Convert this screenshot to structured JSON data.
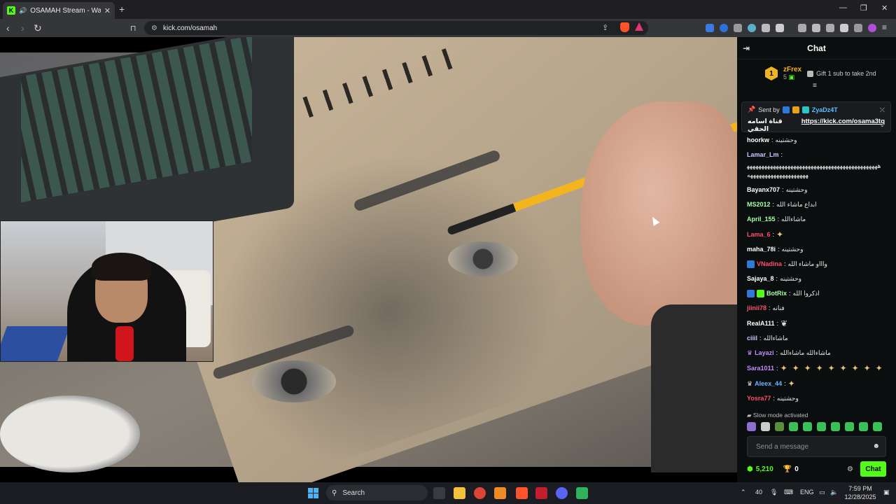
{
  "browser": {
    "tab_title": "OSAMAH Stream - Watch Live",
    "url": "kick.com/osamah"
  },
  "chat": {
    "header": "Chat",
    "leaderboard": {
      "rank": "1",
      "name": "zFrex",
      "count": "5",
      "gift_text": "Gift 1 sub to take 2nd"
    },
    "pinned": {
      "sent_by_label": "Sent by",
      "sender": "ZyaDz4T",
      "text_ar": "قناة اسامه الحقي",
      "link": "https://kick.com/osama3tq"
    },
    "messages": [
      {
        "user": "hoorkw",
        "color": "#ffffff",
        "text": "وحشتينه"
      },
      {
        "user": "Lamar_Lm",
        "color": "#c9c9ff",
        "text": "ههههههههههههههههههههههههههههههههههههههههههههههههههههههههههههههههههه"
      },
      {
        "user": "Bayanx707",
        "color": "#ffffff",
        "text": "وحشتينه"
      },
      {
        "user": "MS2012",
        "color": "#a6ffa6",
        "text": "ابداع ماشاء الله"
      },
      {
        "user": "April_155",
        "color": "#a6ffa6",
        "text": "ماشاءالله"
      },
      {
        "user": "Lama_6",
        "color": "#ff4d6d",
        "text": ""
      },
      {
        "user": "maha_78i",
        "color": "#ffffff",
        "text": "وحشتينه"
      },
      {
        "user": "VNadina",
        "color": "#ff4d6d",
        "text": "واااو ماشاء الله"
      },
      {
        "user": "Sajaya_8",
        "color": "#ffffff",
        "text": "وحشتينه"
      },
      {
        "user": "BotRix",
        "color": "#a6ffa6",
        "text": "اذكروا الله"
      },
      {
        "user": "jiinii78",
        "color": "#ff4d6d",
        "text": "فنانه"
      },
      {
        "user": "RealA111",
        "color": "#ffffff",
        "text": ""
      },
      {
        "user": "ciiil",
        "color": "#c9c9ff",
        "text": "ماشاءالله"
      },
      {
        "user": "Layazi",
        "color": "#c58cff",
        "text": "ماشاءالله ماشاءالله"
      },
      {
        "user": "Sara1011",
        "color": "#c58cff",
        "text": ""
      },
      {
        "user": "Aleex_44",
        "color": "#6fb4ff",
        "text": ""
      },
      {
        "user": "Yosra77",
        "color": "#ff4d6d",
        "text": "وحشتينه"
      }
    ],
    "slow_mode": "Slow mode activated",
    "input_placeholder": "Send a message",
    "points": "5,210",
    "trophies": "0",
    "chat_button": "Chat"
  },
  "taskbar": {
    "search_label": "Search",
    "weather": "40",
    "lang": "ENG",
    "time": "7:59 PM",
    "date": "12/28/2025"
  }
}
